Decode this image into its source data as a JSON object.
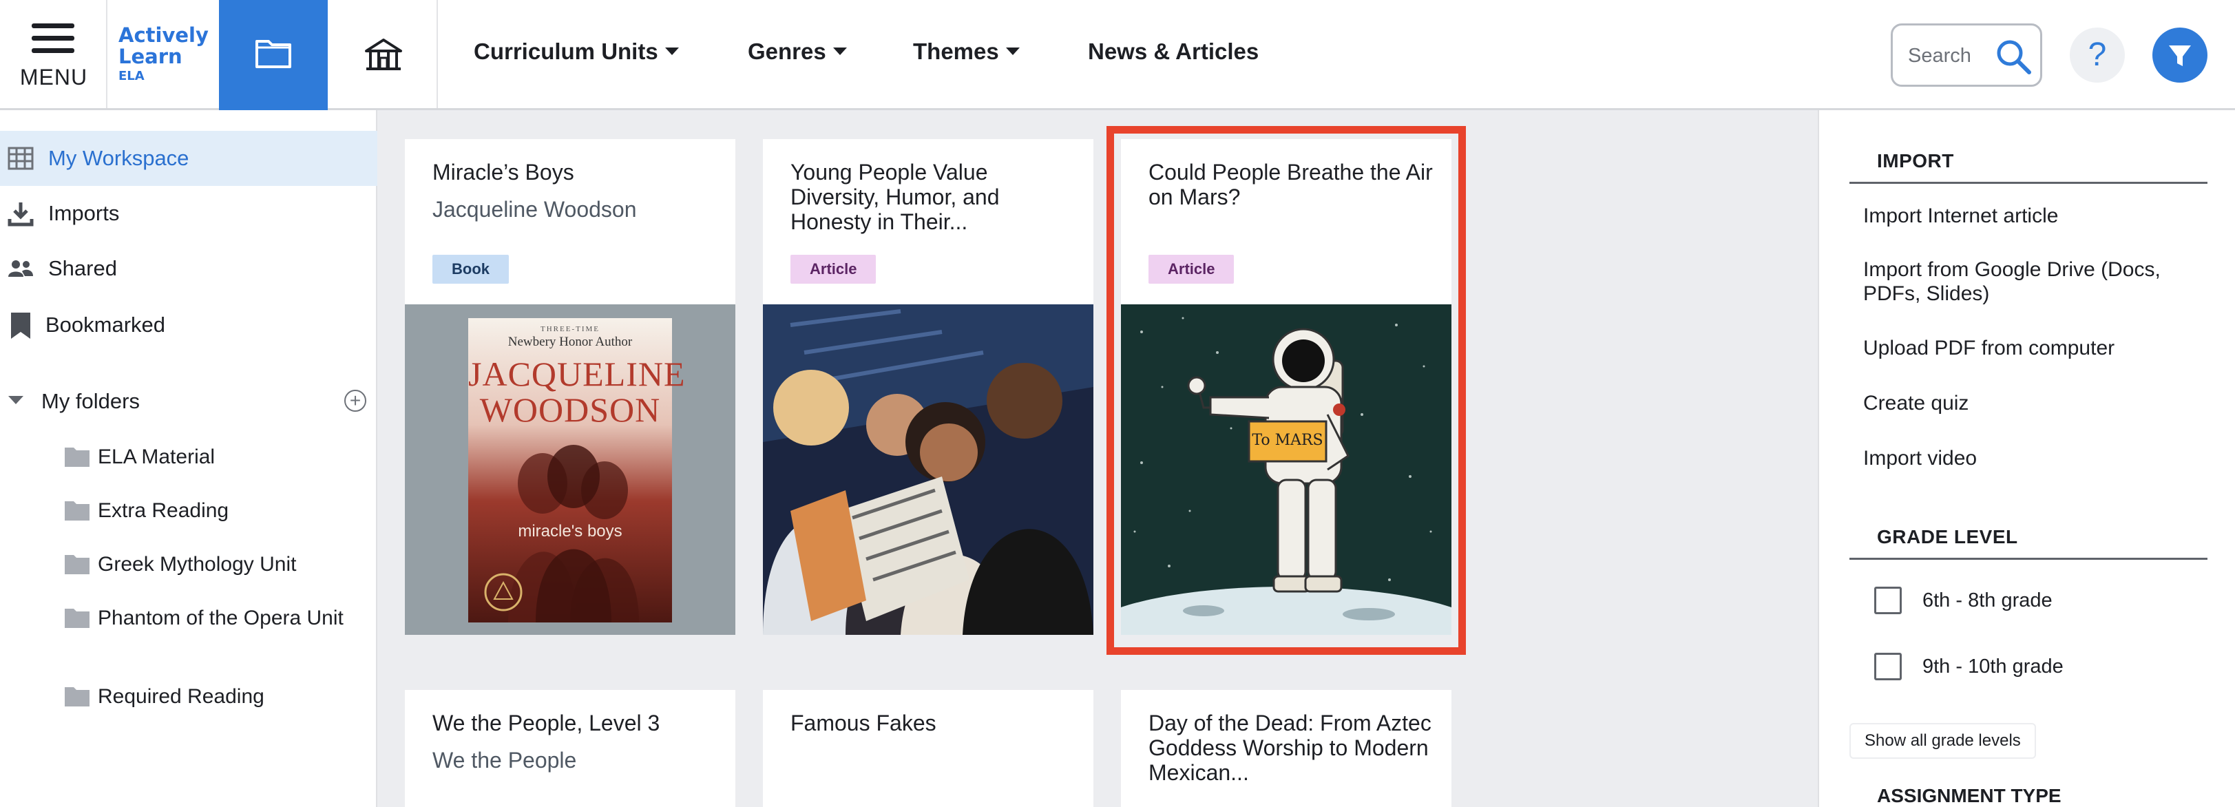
{
  "header": {
    "menu_label": "MENU",
    "logo": {
      "line1": "Actively",
      "line2": "Learn",
      "sub": "ELA"
    },
    "nav": [
      {
        "label": "Curriculum Units",
        "dropdown": true
      },
      {
        "label": "Genres",
        "dropdown": true
      },
      {
        "label": "Themes",
        "dropdown": true
      },
      {
        "label": "News & Articles",
        "dropdown": false
      }
    ],
    "search": {
      "placeholder": "Search",
      "value": ""
    },
    "help_label": "?",
    "colors": {
      "accent": "#2f7bd9",
      "highlight": "#e8432c"
    }
  },
  "sidebar": {
    "items": [
      {
        "label": "My Workspace",
        "icon": "workspace-icon",
        "active": true
      },
      {
        "label": "Imports",
        "icon": "download-icon",
        "active": false
      },
      {
        "label": "Shared",
        "icon": "people-icon",
        "active": false
      },
      {
        "label": "Bookmarked",
        "icon": "bookmark-icon",
        "active": false
      }
    ],
    "folders_label": "My folders",
    "folders": [
      {
        "label": "ELA Material"
      },
      {
        "label": "Extra Reading"
      },
      {
        "label": "Greek Mythology Unit"
      },
      {
        "label": "Phantom of the Opera Unit"
      },
      {
        "label": "Required Reading"
      }
    ]
  },
  "cards": [
    {
      "title": "Miracle’s Boys",
      "author": "Jacqueline Woodson",
      "type": "Book",
      "cover": {
        "top": "THREE-TIME",
        "award": "Newbery Honor Author",
        "name1": "JACQUELINE",
        "name2": "WOODSON",
        "book": "miracle's boys"
      }
    },
    {
      "title": "Young People Value Diversity, Humor, and Honesty in Their...",
      "author": "",
      "type": "Article"
    },
    {
      "title": "Could People Breathe the Air on Mars?",
      "author": "",
      "type": "Article",
      "highlighted": true,
      "sign": "To MARS"
    },
    {
      "title": "We the People, Level 3",
      "author": "We the People",
      "type": ""
    },
    {
      "title": "Famous Fakes",
      "author": "",
      "type": ""
    },
    {
      "title": "Day of the Dead: From Aztec Goddess Worship to Modern Mexican...",
      "author": "",
      "type": ""
    }
  ],
  "right_panel": {
    "import_heading": "IMPORT",
    "import_links": [
      "Import Internet article",
      "Import from Google Drive (Docs, PDFs, Slides)",
      "Upload PDF from computer",
      "Create quiz",
      "Import video"
    ],
    "grade_heading": "GRADE LEVEL",
    "grades": [
      {
        "label": "6th - 8th grade",
        "checked": false
      },
      {
        "label": "9th - 10th grade",
        "checked": false
      }
    ],
    "show_all_label": "Show all grade levels",
    "assignment_heading": "ASSIGNMENT TYPE"
  }
}
